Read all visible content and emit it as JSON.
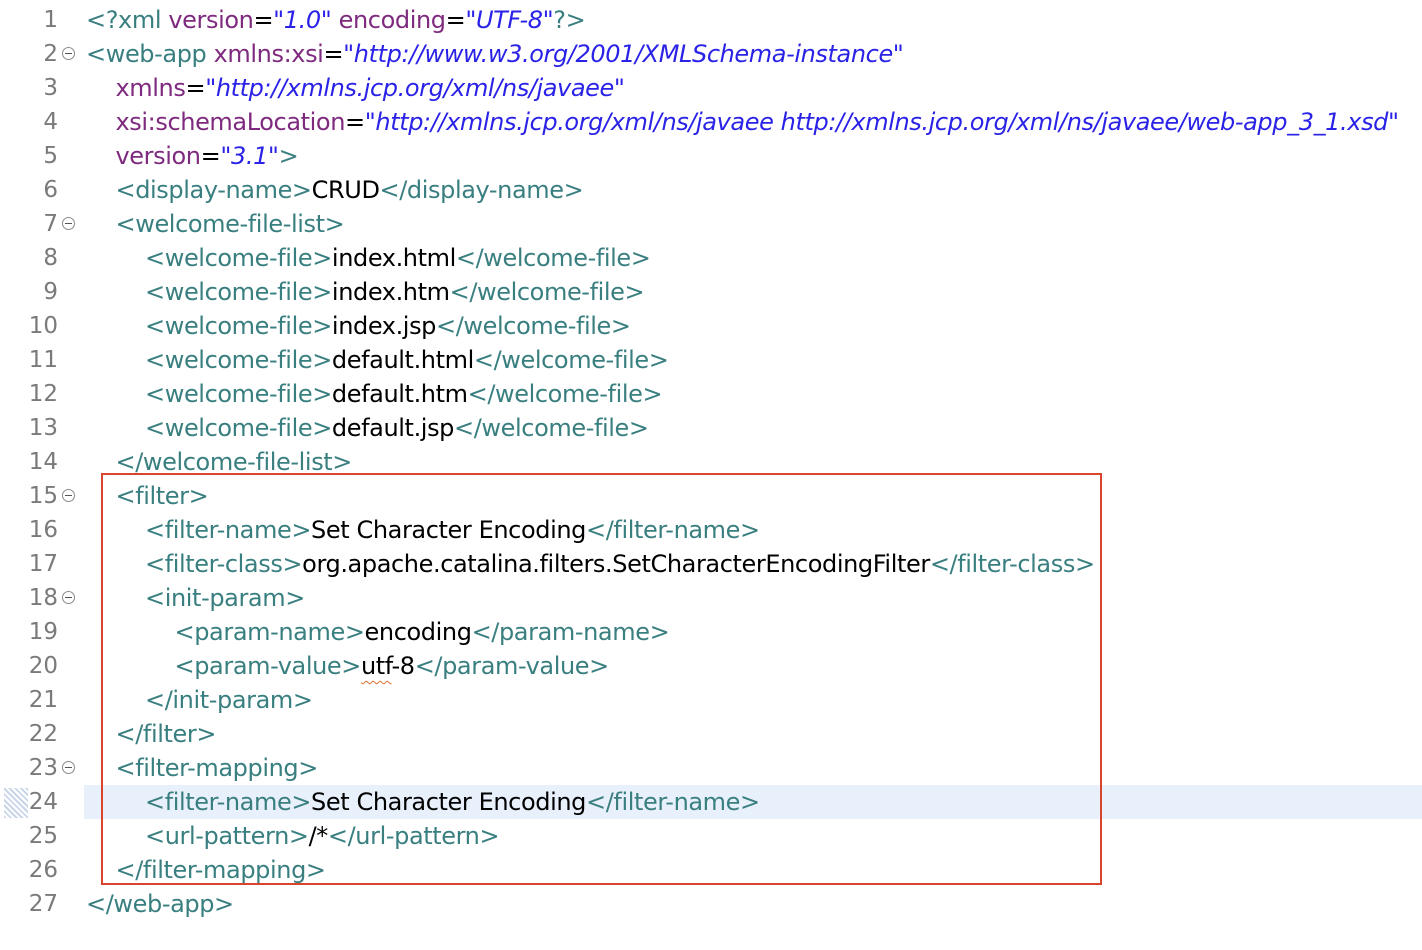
{
  "editor": {
    "current_line": 24,
    "highlight_color": "#d9452c",
    "lines": [
      {
        "num": "1",
        "fold": false,
        "indent": 0,
        "tokens": [
          {
            "t": "<?xml ",
            "c": "pi"
          },
          {
            "t": "version",
            "c": "attr"
          },
          {
            "t": "=",
            "c": "txt"
          },
          {
            "t": "\"1.0\"",
            "c": "val"
          },
          {
            "t": " encoding",
            "c": "attr"
          },
          {
            "t": "=",
            "c": "txt"
          },
          {
            "t": "\"UTF-8\"",
            "c": "val"
          },
          {
            "t": "?>",
            "c": "pi"
          }
        ]
      },
      {
        "num": "2",
        "fold": true,
        "indent": 0,
        "tokens": [
          {
            "t": "<web-app ",
            "c": "tag"
          },
          {
            "t": "xmlns:xsi",
            "c": "attr"
          },
          {
            "t": "=",
            "c": "txt"
          },
          {
            "t": "\"http://www.w3.org/2001/XMLSchema-instance\"",
            "c": "val"
          }
        ]
      },
      {
        "num": "3",
        "fold": false,
        "indent": 1,
        "tokens": [
          {
            "t": "xmlns",
            "c": "attr"
          },
          {
            "t": "=",
            "c": "txt"
          },
          {
            "t": "\"http://xmlns.jcp.org/xml/ns/javaee\"",
            "c": "val"
          }
        ]
      },
      {
        "num": "4",
        "fold": false,
        "indent": 1,
        "tokens": [
          {
            "t": "xsi:schemaLocation",
            "c": "attr"
          },
          {
            "t": "=",
            "c": "txt"
          },
          {
            "t": "\"http://xmlns.jcp.org/xml/ns/javaee http://xmlns.jcp.org/xml/ns/javaee/web-app_3_1.xsd\"",
            "c": "val"
          }
        ]
      },
      {
        "num": "5",
        "fold": false,
        "indent": 1,
        "tokens": [
          {
            "t": "version",
            "c": "attr"
          },
          {
            "t": "=",
            "c": "txt"
          },
          {
            "t": "\"3.1\"",
            "c": "val"
          },
          {
            "t": ">",
            "c": "tag"
          }
        ]
      },
      {
        "num": "6",
        "fold": false,
        "indent": 1,
        "tokens": [
          {
            "t": "<display-name>",
            "c": "tag"
          },
          {
            "t": "CRUD",
            "c": "txt"
          },
          {
            "t": "</display-name>",
            "c": "tag"
          }
        ]
      },
      {
        "num": "7",
        "fold": true,
        "indent": 1,
        "tokens": [
          {
            "t": "<welcome-file-list>",
            "c": "tag"
          }
        ]
      },
      {
        "num": "8",
        "fold": false,
        "indent": 2,
        "tokens": [
          {
            "t": "<welcome-file>",
            "c": "tag"
          },
          {
            "t": "index.html",
            "c": "txt"
          },
          {
            "t": "</welcome-file>",
            "c": "tag"
          }
        ]
      },
      {
        "num": "9",
        "fold": false,
        "indent": 2,
        "tokens": [
          {
            "t": "<welcome-file>",
            "c": "tag"
          },
          {
            "t": "index.htm",
            "c": "txt"
          },
          {
            "t": "</welcome-file>",
            "c": "tag"
          }
        ]
      },
      {
        "num": "10",
        "fold": false,
        "indent": 2,
        "tokens": [
          {
            "t": "<welcome-file>",
            "c": "tag"
          },
          {
            "t": "index.jsp",
            "c": "txt"
          },
          {
            "t": "</welcome-file>",
            "c": "tag"
          }
        ]
      },
      {
        "num": "11",
        "fold": false,
        "indent": 2,
        "tokens": [
          {
            "t": "<welcome-file>",
            "c": "tag"
          },
          {
            "t": "default.html",
            "c": "txt"
          },
          {
            "t": "</welcome-file>",
            "c": "tag"
          }
        ]
      },
      {
        "num": "12",
        "fold": false,
        "indent": 2,
        "tokens": [
          {
            "t": "<welcome-file>",
            "c": "tag"
          },
          {
            "t": "default.htm",
            "c": "txt"
          },
          {
            "t": "</welcome-file>",
            "c": "tag"
          }
        ]
      },
      {
        "num": "13",
        "fold": false,
        "indent": 2,
        "tokens": [
          {
            "t": "<welcome-file>",
            "c": "tag"
          },
          {
            "t": "default.jsp",
            "c": "txt"
          },
          {
            "t": "</welcome-file>",
            "c": "tag"
          }
        ]
      },
      {
        "num": "14",
        "fold": false,
        "indent": 1,
        "tokens": [
          {
            "t": "</welcome-file-list>",
            "c": "tag"
          }
        ]
      },
      {
        "num": "15",
        "fold": true,
        "indent": 1,
        "tokens": [
          {
            "t": "<filter>",
            "c": "tag"
          }
        ]
      },
      {
        "num": "16",
        "fold": false,
        "indent": 2,
        "tokens": [
          {
            "t": "<filter-name>",
            "c": "tag"
          },
          {
            "t": "Set Character Encoding",
            "c": "txt"
          },
          {
            "t": "</filter-name>",
            "c": "tag"
          }
        ]
      },
      {
        "num": "17",
        "fold": false,
        "indent": 2,
        "tokens": [
          {
            "t": "<filter-class>",
            "c": "tag"
          },
          {
            "t": "org.apache.catalina.filters.SetCharacterEncodingFilter",
            "c": "txt"
          },
          {
            "t": "</filter-class>",
            "c": "tag"
          }
        ]
      },
      {
        "num": "18",
        "fold": true,
        "indent": 2,
        "tokens": [
          {
            "t": "<init-param>",
            "c": "tag"
          }
        ]
      },
      {
        "num": "19",
        "fold": false,
        "indent": 3,
        "tokens": [
          {
            "t": "<param-name>",
            "c": "tag"
          },
          {
            "t": "encoding",
            "c": "txt"
          },
          {
            "t": "</param-name>",
            "c": "tag"
          }
        ]
      },
      {
        "num": "20",
        "fold": false,
        "indent": 3,
        "tokens": [
          {
            "t": "<param-value>",
            "c": "tag"
          },
          {
            "t": "utf",
            "c": "txt squig"
          },
          {
            "t": "-8",
            "c": "txt"
          },
          {
            "t": "</param-value>",
            "c": "tag"
          }
        ]
      },
      {
        "num": "21",
        "fold": false,
        "indent": 2,
        "tokens": [
          {
            "t": "</init-param>",
            "c": "tag"
          }
        ]
      },
      {
        "num": "22",
        "fold": false,
        "indent": 1,
        "tokens": [
          {
            "t": "</filter>",
            "c": "tag"
          }
        ]
      },
      {
        "num": "23",
        "fold": true,
        "indent": 1,
        "tokens": [
          {
            "t": "<filter-mapping>",
            "c": "tag"
          }
        ]
      },
      {
        "num": "24",
        "fold": false,
        "indent": 2,
        "tokens": [
          {
            "t": "<filter-name>",
            "c": "tag"
          },
          {
            "t": "Set Character Encoding",
            "c": "txt"
          },
          {
            "t": "</filter-name>",
            "c": "tag"
          }
        ]
      },
      {
        "num": "25",
        "fold": false,
        "indent": 2,
        "tokens": [
          {
            "t": "<url-pattern>",
            "c": "tag"
          },
          {
            "t": "/*",
            "c": "txt"
          },
          {
            "t": "</url-pattern>",
            "c": "tag"
          }
        ]
      },
      {
        "num": "26",
        "fold": false,
        "indent": 1,
        "tokens": [
          {
            "t": "</filter-mapping>",
            "c": "tag"
          }
        ]
      },
      {
        "num": "27",
        "fold": false,
        "indent": 0,
        "tokens": [
          {
            "t": "</web-app>",
            "c": "tag"
          }
        ]
      }
    ]
  }
}
